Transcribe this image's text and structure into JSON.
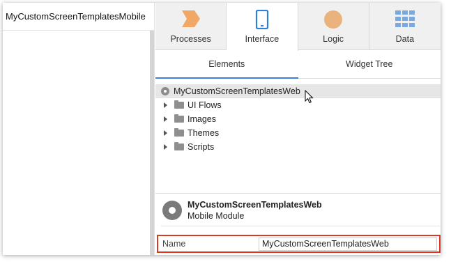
{
  "left_pane": {
    "title": "MyCustomScreenTemplatesMobile"
  },
  "tabs": [
    {
      "label": "Processes",
      "icon": "processes-icon",
      "color": "#f2a865"
    },
    {
      "label": "Interface",
      "icon": "mobile-phone-icon",
      "color": "#2f7fd8"
    },
    {
      "label": "Logic",
      "icon": "logic-circle-icon",
      "color": "#eab37e"
    },
    {
      "label": "Data",
      "icon": "data-grid-icon",
      "color": "#7aa9e0"
    }
  ],
  "active_tab": "Interface",
  "subtabs": [
    {
      "label": "Elements"
    },
    {
      "label": "Widget Tree"
    }
  ],
  "active_subtab": "Elements",
  "tree": {
    "root": {
      "label": "MyCustomScreenTemplatesWeb"
    },
    "children": [
      {
        "label": "UI Flows"
      },
      {
        "label": "Images"
      },
      {
        "label": "Themes"
      },
      {
        "label": "Scripts"
      }
    ]
  },
  "module": {
    "name": "MyCustomScreenTemplatesWeb",
    "type": "Mobile Module"
  },
  "properties": {
    "name_label": "Name",
    "name_value": "MyCustomScreenTemplatesWeb"
  },
  "colors": {
    "accent": "#3b7dd8",
    "highlight_border": "#d93a26"
  }
}
